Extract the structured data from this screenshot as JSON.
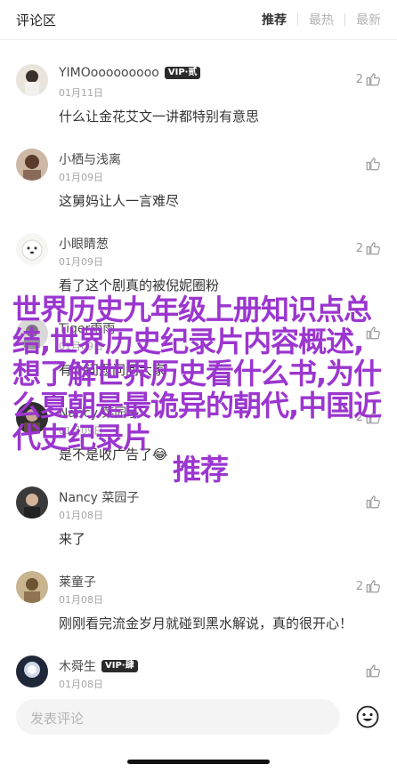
{
  "header": {
    "title": "评论区",
    "tabs": [
      {
        "label": "推荐",
        "active": true
      },
      {
        "label": "最热",
        "active": false
      },
      {
        "label": "最新",
        "active": false
      }
    ]
  },
  "comments": [
    {
      "username": "YIMOooooooooo",
      "badge": "VIP·贰",
      "date": "01月11日",
      "text": "什么让金花艾文一讲都特别有意思",
      "likes": "2"
    },
    {
      "username": "小栖与浅离",
      "badge": "",
      "date": "01月09日",
      "text": "这舅妈让人一言难尽",
      "likes": ""
    },
    {
      "username": "小眼睛葱",
      "badge": "",
      "date": "01月09日",
      "text": "看了这个剧真的被倪妮圈粉",
      "likes": "2"
    },
    {
      "username": "Tiger雨雨",
      "badge": "",
      "date": "01月09日",
      "text": "有个问题问问大家",
      "likes": ""
    },
    {
      "username": "Nancy 菜园子",
      "badge": "",
      "date": "01月09日",
      "text": "是不是收广告了😂",
      "likes": "2"
    },
    {
      "username": "Nancy 菜园子",
      "badge": "",
      "date": "01月08日",
      "text": "来了",
      "likes": ""
    },
    {
      "username": "莱童子",
      "badge": "",
      "date": "01月08日",
      "text": "刚刚看完流金岁月就碰到黑水解说，真的很开心！",
      "likes": "2"
    },
    {
      "username": "木舜生",
      "badge": "VIP·肆",
      "date": "01月08日",
      "text": "",
      "likes": ""
    }
  ],
  "overlay": {
    "text": "世界历史九年级上册知识点总结,世界历史纪录片内容概述,想了解世界历史看什么书,为什么夏朝是最诡异的朝代,中国近代史纪录片",
    "last_line": "推荐",
    "color": "#9b36cf"
  },
  "footer": {
    "input_placeholder": "发表评论"
  },
  "icons": {
    "like": "thumbs-up-icon",
    "emoji": "smiley-icon"
  }
}
